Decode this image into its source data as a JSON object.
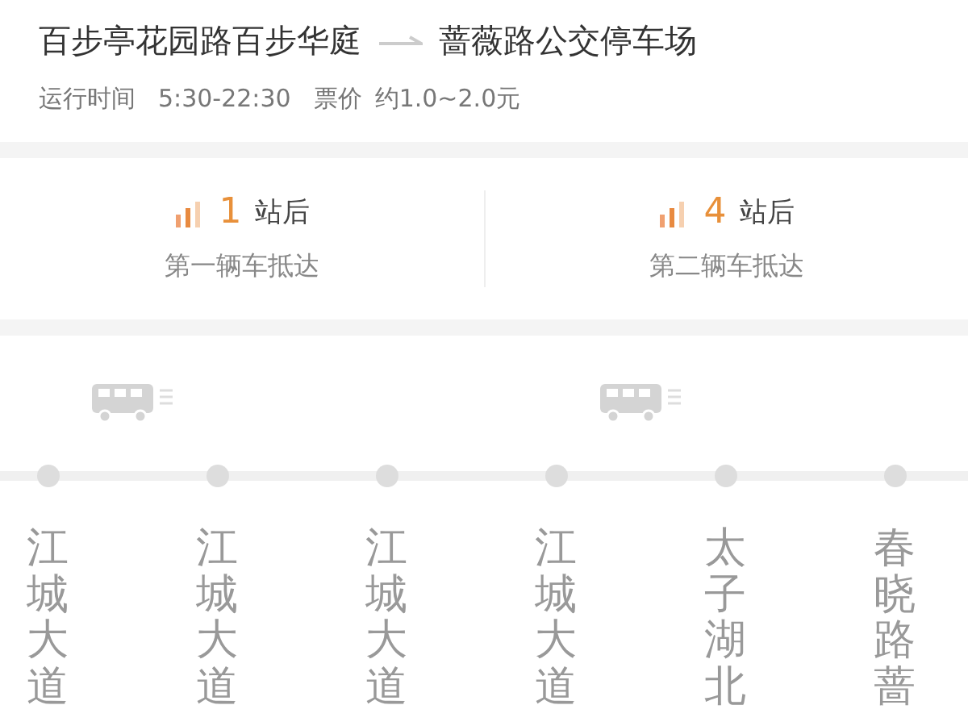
{
  "route": {
    "from": "百步亭花园路百步华庭",
    "to": "蔷薇路公交停车场",
    "hours_label": "运行时间",
    "hours": "5:30-22:30",
    "fare_label": "票价",
    "fare": "约1.0~2.0元"
  },
  "arrivals": [
    {
      "count": "1",
      "unit": "站后",
      "caption": "第一辆车抵达"
    },
    {
      "count": "4",
      "unit": "站后",
      "caption": "第二辆车抵达"
    }
  ],
  "stops": [
    {
      "name": "江城大道",
      "bus_after": true
    },
    {
      "name": "江城大道",
      "bus_after": false
    },
    {
      "name": "江城大道",
      "bus_after": false
    },
    {
      "name": "江城大道",
      "bus_after": true
    },
    {
      "name": "太子湖北",
      "bus_after": false
    },
    {
      "name": "春晓路蔷",
      "bus_after": false
    }
  ]
}
